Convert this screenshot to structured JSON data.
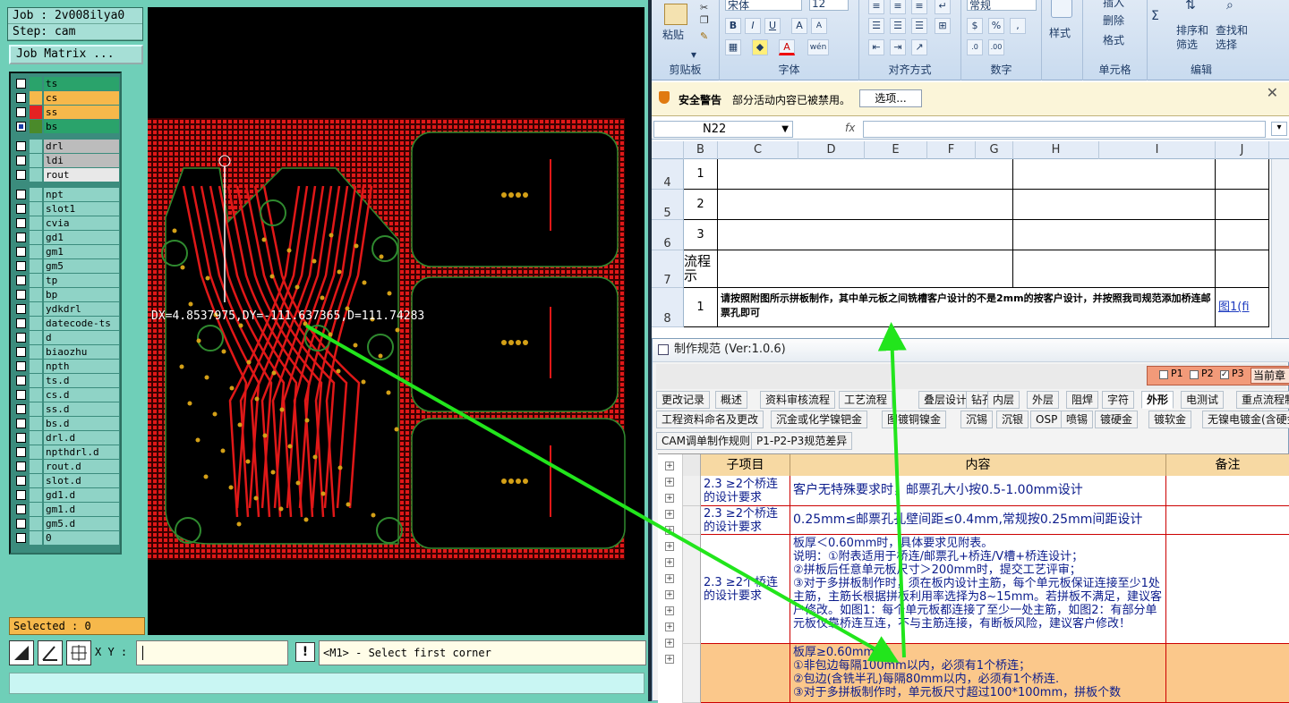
{
  "cam": {
    "job_line": "Job : 2v008ilya0",
    "step_line": "Step: cam",
    "job_matrix_label": "Job Matrix ...",
    "layers": [
      {
        "name": "ts",
        "color": "#2aa36b",
        "swatch": "#2aa36b",
        "checked": false
      },
      {
        "name": "cs",
        "color": "#f6b84b",
        "swatch": "#f6b84b",
        "checked": false
      },
      {
        "name": "ss",
        "color": "#f6b84b",
        "swatch": "#e52222",
        "checked": false
      },
      {
        "name": "bs",
        "color": "#2aa36b",
        "swatch": "#4a8a2a",
        "checked": true
      },
      {
        "name": "drl",
        "color": "#bcbcbc",
        "swatch": "#8fd3c6",
        "checked": false
      },
      {
        "name": "ldi",
        "color": "#bcbcbc",
        "swatch": "#8fd3c6",
        "checked": false
      },
      {
        "name": "rout",
        "color": "#e8e8e8",
        "swatch": "#8fd3c6",
        "checked": false
      },
      {
        "name": "npt",
        "color": "#8fd3c6",
        "swatch": "#8fd3c6",
        "checked": false
      },
      {
        "name": "slot1",
        "color": "#8fd3c6",
        "swatch": "#8fd3c6",
        "checked": false
      },
      {
        "name": "cvia",
        "color": "#8fd3c6",
        "swatch": "#8fd3c6",
        "checked": false
      },
      {
        "name": "gd1",
        "color": "#8fd3c6",
        "swatch": "#8fd3c6",
        "checked": false
      },
      {
        "name": "gm1",
        "color": "#8fd3c6",
        "swatch": "#8fd3c6",
        "checked": false
      },
      {
        "name": "gm5",
        "color": "#8fd3c6",
        "swatch": "#8fd3c6",
        "checked": false
      },
      {
        "name": "tp",
        "color": "#8fd3c6",
        "swatch": "#8fd3c6",
        "checked": false
      },
      {
        "name": "bp",
        "color": "#8fd3c6",
        "swatch": "#8fd3c6",
        "checked": false
      },
      {
        "name": "ydkdrl",
        "color": "#8fd3c6",
        "swatch": "#8fd3c6",
        "checked": false
      },
      {
        "name": "datecode-ts",
        "color": "#8fd3c6",
        "swatch": "#8fd3c6",
        "checked": false
      },
      {
        "name": "d",
        "color": "#8fd3c6",
        "swatch": "#8fd3c6",
        "checked": false
      },
      {
        "name": "biaozhu",
        "color": "#8fd3c6",
        "swatch": "#8fd3c6",
        "checked": false
      },
      {
        "name": "npth",
        "color": "#8fd3c6",
        "swatch": "#8fd3c6",
        "checked": false
      },
      {
        "name": "ts.d",
        "color": "#8fd3c6",
        "swatch": "#8fd3c6",
        "checked": false
      },
      {
        "name": "cs.d",
        "color": "#8fd3c6",
        "swatch": "#8fd3c6",
        "checked": false
      },
      {
        "name": "ss.d",
        "color": "#8fd3c6",
        "swatch": "#8fd3c6",
        "checked": false
      },
      {
        "name": "bs.d",
        "color": "#8fd3c6",
        "swatch": "#8fd3c6",
        "checked": false
      },
      {
        "name": "drl.d",
        "color": "#8fd3c6",
        "swatch": "#8fd3c6",
        "checked": false
      },
      {
        "name": "npthdrl.d",
        "color": "#8fd3c6",
        "swatch": "#8fd3c6",
        "checked": false
      },
      {
        "name": "rout.d",
        "color": "#8fd3c6",
        "swatch": "#8fd3c6",
        "checked": false
      },
      {
        "name": "slot.d",
        "color": "#8fd3c6",
        "swatch": "#8fd3c6",
        "checked": false
      },
      {
        "name": "gd1.d",
        "color": "#8fd3c6",
        "swatch": "#8fd3c6",
        "checked": false
      },
      {
        "name": "gm1.d",
        "color": "#8fd3c6",
        "swatch": "#8fd3c6",
        "checked": false
      },
      {
        "name": "gm5.d",
        "color": "#8fd3c6",
        "swatch": "#8fd3c6",
        "checked": false
      },
      {
        "name": "0",
        "color": "#8fd3c6",
        "swatch": "#8fd3c6",
        "checked": false
      }
    ],
    "selected_label": "Selected : 0",
    "measure_readout": "DX=4.8537975,DY=-111.637365,D=111.74283",
    "xy_label": "X Y :",
    "xy_value": "",
    "bang_label": "!",
    "prompt": "<M1> - Select first corner",
    "board_colors": {
      "copper": "#e01818",
      "pad": "#d4a017",
      "outline": "#2f8a2f",
      "background": "#000000"
    }
  },
  "excel": {
    "ribbon": {
      "paste": "粘贴",
      "clipboard": "剪贴板",
      "font_name": "宋体",
      "font_size": "12",
      "font_group": "字体",
      "align_group": "对齐方式",
      "number_format": "常规",
      "number_group": "数字",
      "style": "样式",
      "insert": "插入",
      "delete": "删除",
      "format": "格式",
      "cells_group": "单元格",
      "sort_filter": "排序和\n筛选",
      "find_select": "查找和\n选择",
      "edit_group": "编辑"
    },
    "security": {
      "title": "安全警告",
      "message": "部分活动内容已被禁用。",
      "button": "选项..."
    },
    "name_box": "N22",
    "fx": "fx",
    "formula": "",
    "columns": [
      "B",
      "C",
      "D",
      "E",
      "F",
      "G",
      "H",
      "I",
      "J"
    ],
    "rows": [
      {
        "num": "4",
        "b": "1",
        "c": ""
      },
      {
        "num": "5",
        "b": "2",
        "c": ""
      },
      {
        "num": "6",
        "b": "3",
        "c": ""
      },
      {
        "num": "7",
        "b": "流程\n示",
        "c": ""
      },
      {
        "num": "8",
        "b": "1",
        "c": "请按照附图所示拼板制作，其中单元板之间铣槽客户设计的不是2mm的按客户设计，并按照我司规范添加桥连邮票孔即可",
        "j": "图1(fi"
      }
    ]
  },
  "spec": {
    "title": "制作规范 (Ver:1.0.6)",
    "pages": [
      {
        "label": "P1",
        "checked": false
      },
      {
        "label": "P2",
        "checked": false
      },
      {
        "label": "P3",
        "checked": true
      }
    ],
    "current_label": "当前章",
    "tabs_row1": [
      "更改记录",
      "概述",
      "资料审核流程",
      "工艺流程",
      "叠层设计",
      "钻孔",
      "内层",
      "外层",
      "阻焊",
      "字符",
      "外形",
      "电测试",
      "重点流程制作"
    ],
    "tabs_row2": [
      "工程资料命名及更改",
      "沉金或化学镍钯金",
      "图镀铜镍金",
      "沉锡",
      "沉银",
      "OSP",
      "喷锡",
      "镀硬金",
      "镀软金",
      "无镍电镀金(含硬金、软"
    ],
    "tabs_row3": [
      "CAM调单制作规则",
      "P1-P2-P3规范差异"
    ],
    "active_tab": "外形",
    "grid_headers": [
      "子项目",
      "内容",
      "备注"
    ],
    "grid_rows": [
      {
        "sub": "2.3 ≥2个桥连的设计要求",
        "content": "客户无特殊要求时，邮票孔大小按0.5-1.00mm设计",
        "note": "",
        "highlight": false
      },
      {
        "sub": "2.3 ≥2个桥连的设计要求",
        "content": "0.25mm≤邮票孔孔壁间距≤0.4mm,常规按0.25mm间距设计",
        "note": "",
        "highlight": false
      },
      {
        "sub": "2.3 ≥2个桥连的设计要求",
        "content": "板厚＜0.60mm时，具体要求见附表。\n说明：①附表适用于桥连/邮票孔+桥连/V槽+桥连设计；\n②拼板后任意单元板尺寸＞200mm时，提交工艺评审；\n③对于多拼板制作时，须在板内设计主筋，每个单元板保证连接至少1处主筋，主筋长根据拼板利用率选择为8~15mm。若拼板不满足，建议客户修改。如图1：每个单元板都连接了至少一处主筋，如图2：有部分单元板仅靠桥连互连，不与主筋连接，有断板风险，建议客户修改！",
        "note": "",
        "highlight": false
      },
      {
        "sub": "",
        "content": "板厚≥0.60mm时：\n①非包边每隔100mm以内，必须有1个桥连；\n②包边(含铣半孔)每隔80mm以内，必须有1个桥连.\n③对于多拼板制作时，单元板尺寸超过100*100mm，拼板个数",
        "note": "",
        "highlight": true
      }
    ],
    "arrow_color": "#22e51c"
  }
}
